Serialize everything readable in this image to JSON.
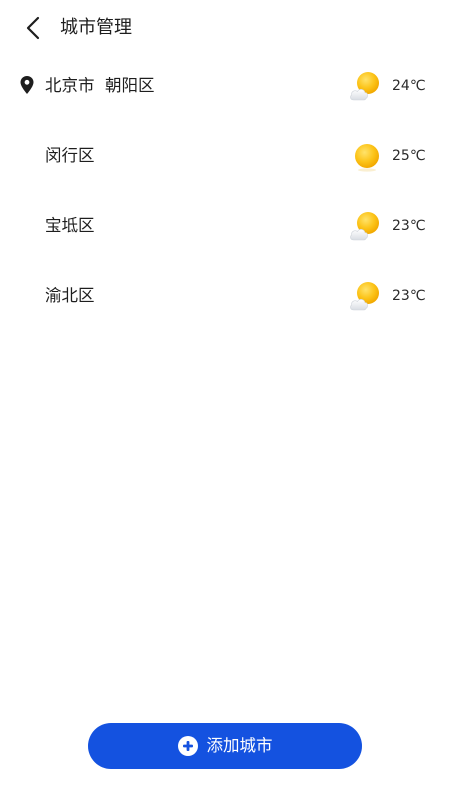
{
  "colors": {
    "accent": "#1452e0",
    "text": "#1e1e1e",
    "sun": "#fcc419",
    "background": "#ffffff"
  },
  "header": {
    "back_icon": "chevron-left-icon",
    "title": "城市管理"
  },
  "cities": [
    {
      "name": "北京市  朝阳区",
      "current_location": true,
      "weather_icon": "partly-cloudy-icon",
      "temperature": "24℃"
    },
    {
      "name": "闵行区",
      "current_location": false,
      "weather_icon": "sunny-icon",
      "temperature": "25℃"
    },
    {
      "name": "宝坻区",
      "current_location": false,
      "weather_icon": "partly-cloudy-icon",
      "temperature": "23℃"
    },
    {
      "name": "渝北区",
      "current_location": false,
      "weather_icon": "partly-cloudy-icon",
      "temperature": "23℃"
    }
  ],
  "footer": {
    "add_icon": "plus-circle-icon",
    "add_label": "添加城市"
  }
}
